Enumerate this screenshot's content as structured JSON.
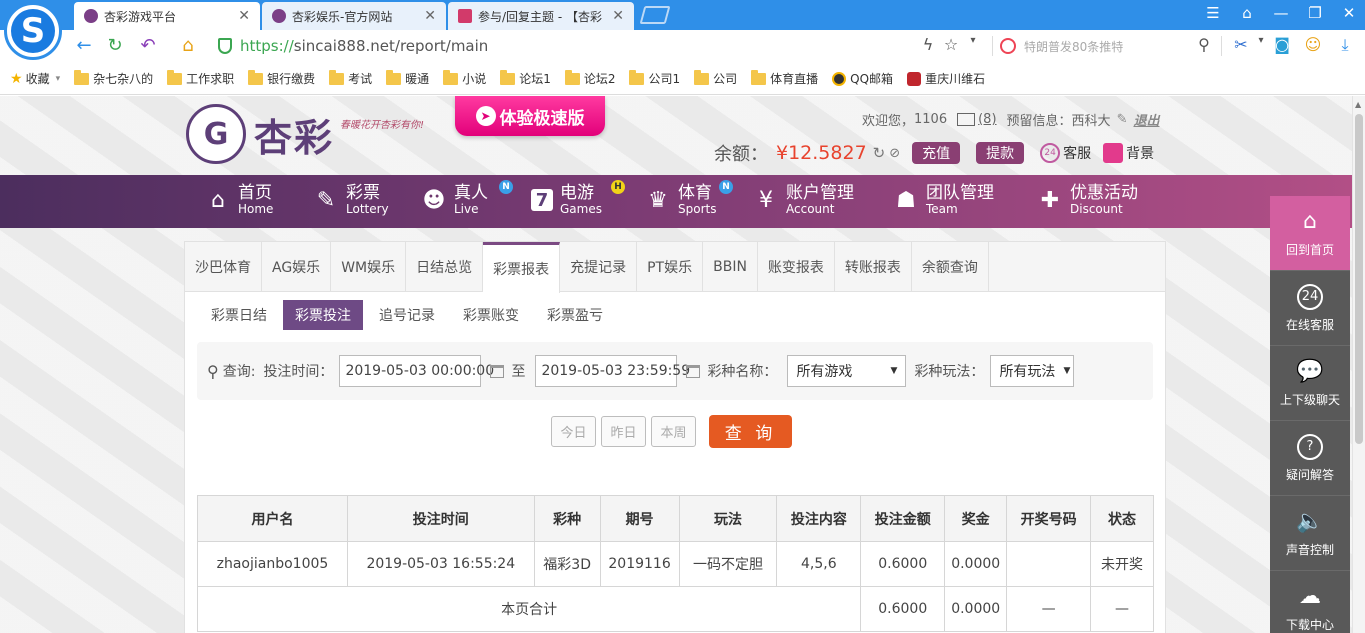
{
  "browser": {
    "tabs": [
      {
        "label": "杏彩游戏平台",
        "active": true
      },
      {
        "label": "杏彩娱乐-官方网站",
        "active": false
      },
      {
        "label": "参与/回复主题 - 【杏彩",
        "active": false
      }
    ],
    "url_proto": "https://",
    "url_rest": "sincai888.net/report/main",
    "search_placeholder": "特朗普发80条推特",
    "bookmarks": [
      {
        "label": "收藏",
        "icon": "star-icon"
      },
      {
        "label": "杂七杂八的",
        "icon": "folder-icon"
      },
      {
        "label": "工作求职",
        "icon": "folder-icon"
      },
      {
        "label": "银行缴费",
        "icon": "folder-icon"
      },
      {
        "label": "考试",
        "icon": "folder-icon"
      },
      {
        "label": "暖通",
        "icon": "folder-icon"
      },
      {
        "label": "小说",
        "icon": "folder-icon"
      },
      {
        "label": "论坛1",
        "icon": "folder-icon"
      },
      {
        "label": "论坛2",
        "icon": "folder-icon"
      },
      {
        "label": "公司1",
        "icon": "folder-icon"
      },
      {
        "label": "公司",
        "icon": "folder-icon"
      },
      {
        "label": "体育直播",
        "icon": "folder-icon"
      },
      {
        "label": "QQ邮箱",
        "icon": "qq-icon"
      },
      {
        "label": "重庆川维石",
        "icon": "site-icon"
      }
    ]
  },
  "header": {
    "logo_text": "杏彩",
    "slogan": "春暖花开杏彩有你!",
    "speed_banner": "体验极速版",
    "welcome": "欢迎您，",
    "user_id": "1106",
    "mail_count": "(8)",
    "warning_label": "预留信息：",
    "warning_value": "西科大",
    "logout": "退出",
    "balance_label": "余额：",
    "balance_value": "¥12.5827",
    "deposit": "充值",
    "withdraw": "提款",
    "service": "客服",
    "background": "背景"
  },
  "nav": [
    {
      "cn": "首页",
      "en": "Home",
      "icon": "home-icon"
    },
    {
      "cn": "彩票",
      "en": "Lottery",
      "icon": "lottery-icon"
    },
    {
      "cn": "真人",
      "en": "Live",
      "icon": "live-icon",
      "badge": "N"
    },
    {
      "cn": "电游",
      "en": "Games",
      "icon": "games-icon",
      "badge": "H"
    },
    {
      "cn": "体育",
      "en": "Sports",
      "icon": "trophy-icon",
      "badge": "N"
    },
    {
      "cn": "账户管理",
      "en": "Account",
      "icon": "account-icon"
    },
    {
      "cn": "团队管理",
      "en": "Team",
      "icon": "team-icon"
    },
    {
      "cn": "优惠活动",
      "en": "Discount",
      "icon": "gift-icon"
    }
  ],
  "report_tabs": [
    "沙巴体育",
    "AG娱乐",
    "WM娱乐",
    "日结总览",
    "彩票报表",
    "充提记录",
    "PT娱乐",
    "BBIN",
    "账变报表",
    "转账报表",
    "余额查询"
  ],
  "report_tab_active": "彩票报表",
  "sub_tabs": [
    "彩票日结",
    "彩票投注",
    "追号记录",
    "彩票账变",
    "彩票盈亏"
  ],
  "sub_tab_active": "彩票投注",
  "filter": {
    "query_label": "查询:",
    "time_label": "投注时间：",
    "start": "2019-05-03 00:00:00",
    "to": "至",
    "end": "2019-05-03 23:59:59",
    "game_label": "彩种名称：",
    "game_value": "所有游戏",
    "play_label": "彩种玩法：",
    "play_value": "所有玩法"
  },
  "quick": {
    "today": "今日",
    "yesterday": "昨日",
    "week": "本周",
    "query": "查 询"
  },
  "table": {
    "headers": [
      "用户名",
      "投注时间",
      "彩种",
      "期号",
      "玩法",
      "投注内容",
      "投注金额",
      "奖金",
      "开奖号码",
      "状态"
    ],
    "rows": [
      [
        "zhaojianbo1005",
        "2019-05-03 16:55:24",
        "福彩3D",
        "2019116",
        "一码不定胆",
        "4,5,6",
        "0.6000",
        "0.0000",
        "",
        "未开奖"
      ]
    ],
    "total_label": "本页合计",
    "total_amount": "0.6000",
    "total_bonus": "0.0000",
    "total_numbers": "—",
    "total_status": "—"
  },
  "right_float": [
    {
      "label": "回到首页",
      "icon": "home-icon"
    },
    {
      "label": "在线客服",
      "icon": "headset-icon"
    },
    {
      "label": "上下级聊天",
      "icon": "chat-icon"
    },
    {
      "label": "疑问解答",
      "icon": "question-icon"
    },
    {
      "label": "声音控制",
      "icon": "speaker-icon"
    },
    {
      "label": "下载中心",
      "icon": "download-icon"
    }
  ],
  "colors": {
    "accent": "#6e4a85",
    "nav_start": "#4c2e5e",
    "nav_end": "#b24f86",
    "query_button": "#e55a22",
    "balance": "#e8432e",
    "status_pending": "#2e8b2e"
  }
}
